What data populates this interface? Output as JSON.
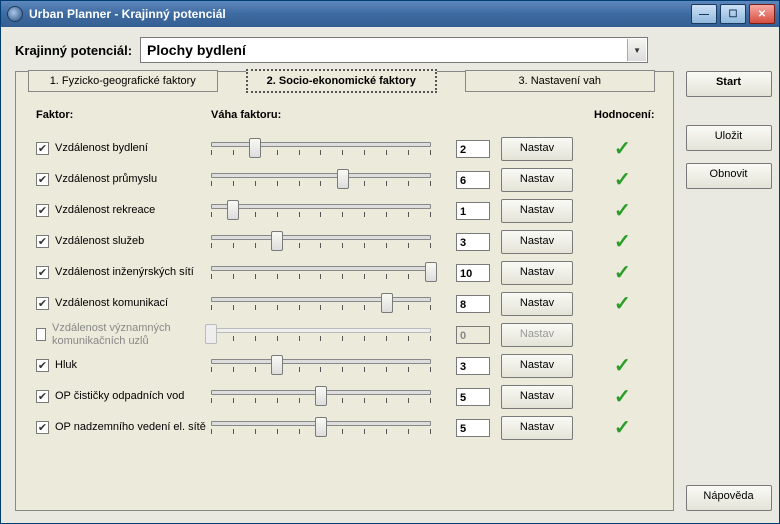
{
  "window": {
    "title": "Urban Planner - Krajinný potenciál"
  },
  "top": {
    "label": "Krajinný potenciál:",
    "combo_value": "Plochy bydlení"
  },
  "tabs": [
    {
      "label": "1. Fyzicko-geografické faktory"
    },
    {
      "label": "2. Socio-ekonomické faktory"
    },
    {
      "label": "3. Nastavení vah"
    }
  ],
  "headers": {
    "factor": "Faktor:",
    "weight": "Váha faktoru:",
    "rating": "Hodnocení:"
  },
  "nastav_label": "Nastav",
  "slider_max": 10,
  "factors": [
    {
      "checked": true,
      "name": "Vzdálenost bydlení",
      "value": 2,
      "enabled": true,
      "ok": true
    },
    {
      "checked": true,
      "name": "Vzdálenost průmyslu",
      "value": 6,
      "enabled": true,
      "ok": true
    },
    {
      "checked": true,
      "name": "Vzdálenost rekreace",
      "value": 1,
      "enabled": true,
      "ok": true
    },
    {
      "checked": true,
      "name": "Vzdálenost služeb",
      "value": 3,
      "enabled": true,
      "ok": true
    },
    {
      "checked": true,
      "name": "Vzdálenost inženýrských sítí",
      "value": 10,
      "enabled": true,
      "ok": true
    },
    {
      "checked": true,
      "name": "Vzdálenost komunikací",
      "value": 8,
      "enabled": true,
      "ok": true
    },
    {
      "checked": false,
      "name": "Vzdálenost významných komunikačních uzlů",
      "value": 0,
      "enabled": false,
      "ok": false
    },
    {
      "checked": true,
      "name": "Hluk",
      "value": 3,
      "enabled": true,
      "ok": true
    },
    {
      "checked": true,
      "name": "OP čističky odpadních vod",
      "value": 5,
      "enabled": true,
      "ok": true
    },
    {
      "checked": true,
      "name": "OP nadzemního vedení el. sítě",
      "value": 5,
      "enabled": true,
      "ok": true
    }
  ],
  "sidebar": {
    "start": "Start",
    "save": "Uložit",
    "refresh": "Obnovit",
    "help": "Nápověda"
  }
}
